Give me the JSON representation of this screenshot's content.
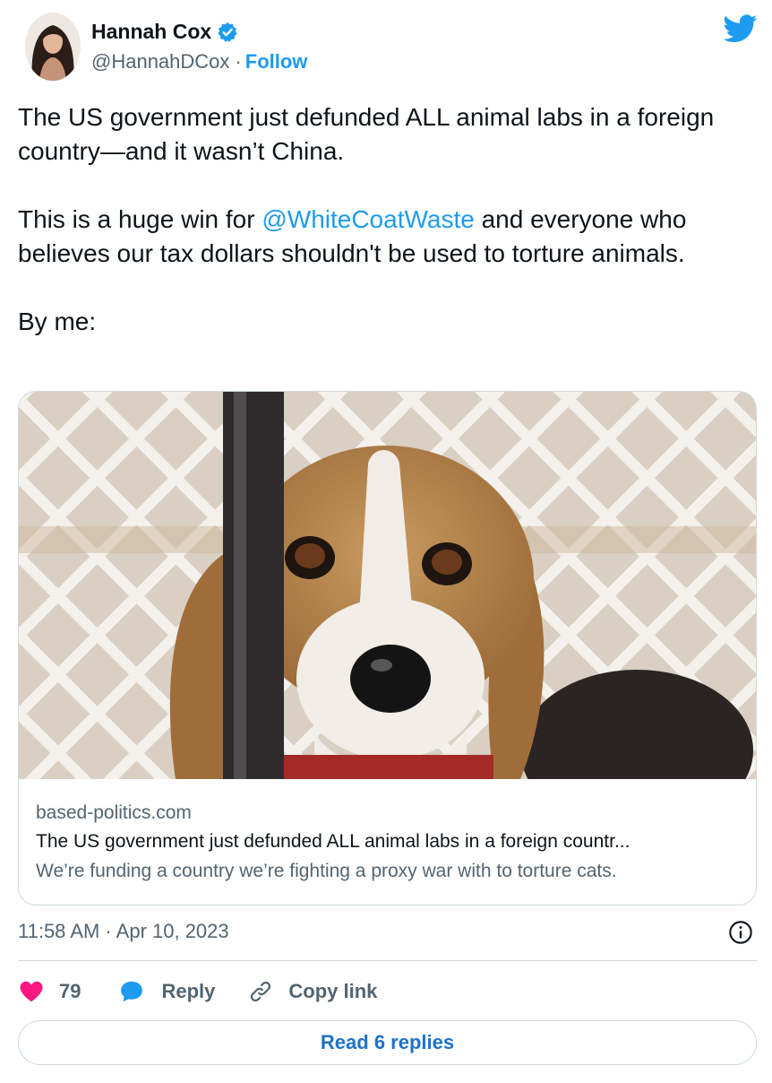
{
  "author": {
    "name": "Hannah Cox",
    "handle": "@HannahDCox",
    "separator": "·",
    "follow_label": "Follow"
  },
  "tweet": {
    "paragraphs": [
      {
        "text": "The US government just defunded ALL animal labs in a foreign country—and it wasn’t China."
      },
      {
        "before": "This is a huge win for ",
        "mention": "@WhiteCoatWaste",
        "after": " and everyone who believes our tax dollars shouldn't be used to torture animals."
      },
      {
        "text": "By me:"
      }
    ]
  },
  "card": {
    "domain": "based-politics.com",
    "title": "The US government just defunded ALL animal labs in a foreign countr...",
    "description": "We’re funding a country we’re fighting a proxy war with to torture cats."
  },
  "timestamp": "11:58 AM · Apr 10, 2023",
  "actions": {
    "like_count": "79",
    "reply_label": "Reply",
    "copy_label": "Copy link"
  },
  "read_replies_label": "Read 6 replies",
  "icons": {
    "verified": "verified-badge-icon",
    "twitter": "twitter-bird-icon",
    "info": "info-icon",
    "like": "heart-icon",
    "reply": "speech-bubble-icon",
    "copy": "link-icon"
  },
  "colors": {
    "accent": "#1d9bf0",
    "like": "#f91880",
    "muted_text": "#536471",
    "border": "#cfd9de"
  }
}
